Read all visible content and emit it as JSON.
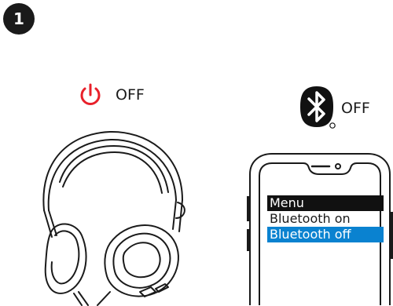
{
  "step": {
    "number": "1"
  },
  "power": {
    "state_label": "OFF",
    "icon": "power-icon",
    "icon_color": "#e8202a"
  },
  "bluetooth": {
    "state_label": "OFF",
    "icon": "bluetooth-icon"
  },
  "phone_menu": {
    "header": "Menu",
    "items": [
      {
        "label": "Bluetooth on",
        "selected": false
      },
      {
        "label": "Bluetooth off",
        "selected": true
      }
    ],
    "highlight_color": "#0a82d0"
  }
}
